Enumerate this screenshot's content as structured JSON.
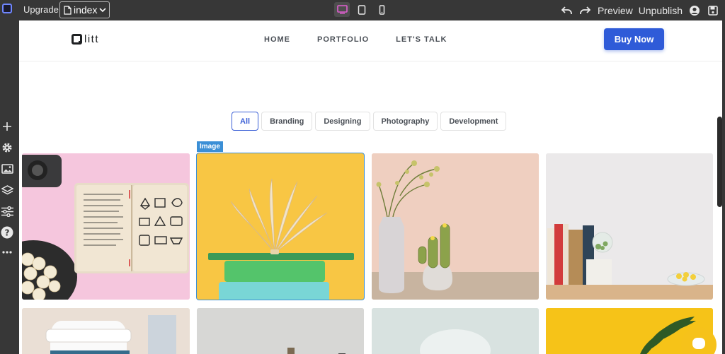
{
  "editor": {
    "upgrade_label": "Upgrade",
    "page_select": "index",
    "preview_label": "Preview",
    "unpublish_label": "Unpublish",
    "devices": [
      "desktop-icon",
      "tablet-icon",
      "mobile-icon"
    ],
    "active_device": "desktop",
    "left_tools": [
      "plus-icon",
      "gear-icon",
      "image-icon",
      "layers-icon",
      "sliders-icon",
      "help-icon",
      "more-icon"
    ]
  },
  "site": {
    "brand": "litt",
    "nav": [
      "HOME",
      "PORTFOLIO",
      "LET'S TALK"
    ],
    "buy_label": "Buy Now"
  },
  "filters": [
    "All",
    "Branding",
    "Designing",
    "Photography",
    "Development"
  ],
  "active_filter": "All",
  "selected_badge": "Image",
  "colors": {
    "editor_bg": "#373737",
    "accent": "#2f5bd8",
    "selection": "#3b8fd6",
    "chat": "#f6c21a"
  },
  "gallery": [
    {
      "subject": "notebook-popcorn-camera",
      "bg": "#f5c6dd"
    },
    {
      "subject": "book-on-stack",
      "bg": "#f8c644"
    },
    {
      "subject": "vase-cactus",
      "bg": "#efcfc0"
    },
    {
      "subject": "books-shelf",
      "bg": "#ebe9ea"
    },
    {
      "subject": "coffee-cup",
      "bg": "#eadfd5"
    },
    {
      "subject": "shelf-objects",
      "bg": "#d7d7d5"
    },
    {
      "subject": "light-mist",
      "bg": "#d8e2e0"
    },
    {
      "subject": "yellow-leaves",
      "bg": "#f6c318"
    }
  ]
}
